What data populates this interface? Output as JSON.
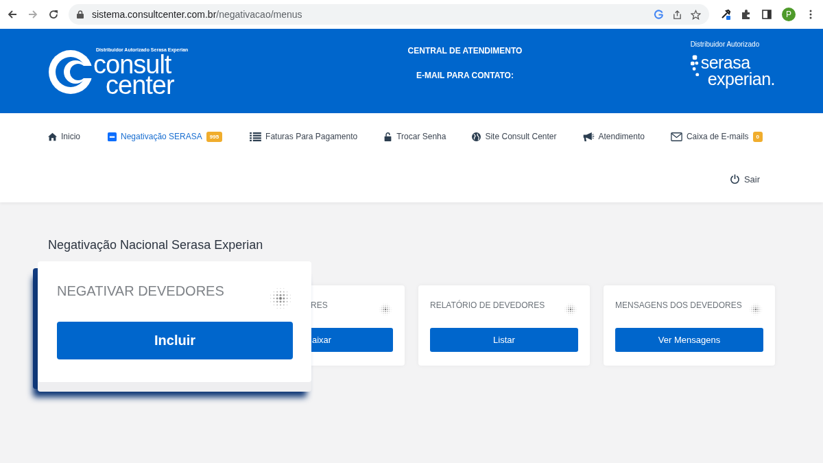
{
  "browser": {
    "url_host": "sistema.consultcenter.com.br",
    "url_path": "/negativacao/menus",
    "profile_initial": "P"
  },
  "header": {
    "logo_tagline": "Distribuidor Autorizado Serasa Experian",
    "logo_line1": "consult",
    "logo_line2": "center",
    "contact_lines": [
      "CENTRAL DE ATENDIMENTO",
      "E-MAIL PARA CONTATO:"
    ],
    "partner_caption": "Distribuidor Autorizado",
    "partner_line1": "serasa",
    "partner_line2": "experian."
  },
  "nav": [
    {
      "label": "Inicio",
      "selected": false
    },
    {
      "label": "Negativação SERASA",
      "selected": true,
      "badge": "995"
    },
    {
      "label": "Faturas Para Pagamento",
      "selected": false
    },
    {
      "label": "Trocar Senha",
      "selected": false
    },
    {
      "label": "Site Consult Center",
      "selected": false
    },
    {
      "label": "Atendimento",
      "selected": false
    },
    {
      "label": "Caixa de E-mails",
      "selected": false,
      "badge": "0"
    }
  ],
  "logout": "Sair",
  "section_title": "Negativação Nacional Serasa Experian",
  "popup_card": {
    "title": "NEGATIVAR DEVEDORES",
    "button": "Incluir"
  },
  "cards": [
    {
      "title": "RES",
      "button": "aixar",
      "partly_covered": true
    },
    {
      "title": "RELATÓRIO DE DEVEDORES",
      "button": "Listar",
      "partly_covered": false
    },
    {
      "title": "MENSAGENS DOS DEVEDORES",
      "button": "Ver Mensagens",
      "partly_covered": false
    }
  ]
}
